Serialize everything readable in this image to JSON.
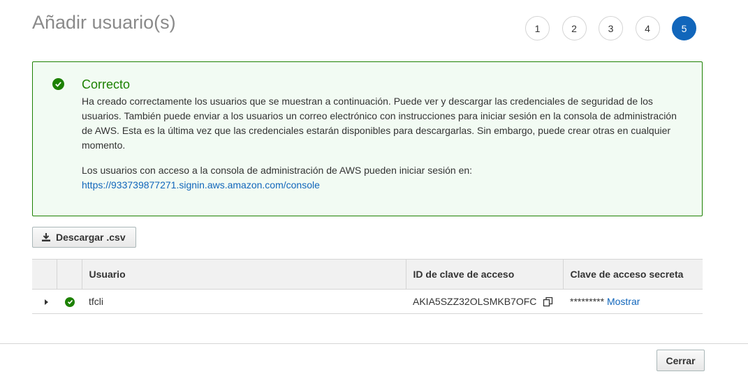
{
  "page": {
    "title": "Añadir usuario(s)"
  },
  "steps": [
    "1",
    "2",
    "3",
    "4",
    "5"
  ],
  "active_step": "5",
  "alert": {
    "title": "Correcto",
    "paragraph1": "Ha creado correctamente los usuarios que se muestran a continuación. Puede ver y descargar las credenciales de seguridad de los usuarios. También puede enviar a los usuarios un correo electrónico con instrucciones para iniciar sesión en la consola de administración de AWS. Esta es la última vez que las credenciales estarán disponibles para descargarlas. Sin embargo, puede crear otras en cualquier momento.",
    "paragraph2": "Los usuarios con acceso a la consola de administración de AWS pueden iniciar sesión en:",
    "console_link": "https://933739877271.signin.aws.amazon.com/console"
  },
  "toolbar": {
    "download_label": "Descargar .csv"
  },
  "table": {
    "headers": {
      "user": "Usuario",
      "access_key_id": "ID de clave de acceso",
      "secret_key": "Clave de acceso secreta"
    },
    "rows": [
      {
        "user": "tfcli",
        "access_key_id": "AKIA5SZZ32OLSMKB7OFC",
        "secret_mask": "*********",
        "show_label": "Mostrar"
      }
    ]
  },
  "footer": {
    "close_label": "Cerrar"
  },
  "colors": {
    "success": "#1d8102",
    "link": "#1166bb",
    "active_step": "#1166bb"
  }
}
